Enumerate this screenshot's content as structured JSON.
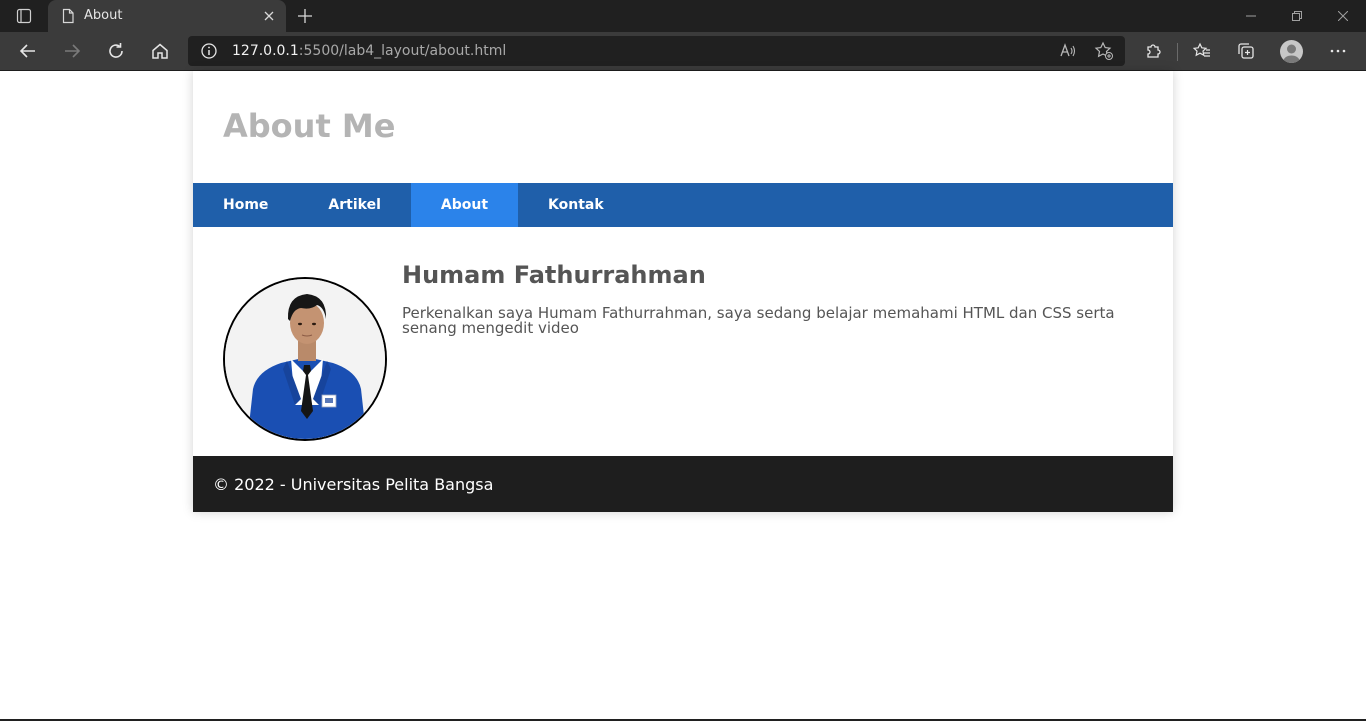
{
  "browser": {
    "tab_title": "About",
    "url_host": "127.0.0.1",
    "url_rest": ":5500/lab4_layout/about.html",
    "icons": {
      "tab_actions": "tab-actions-icon",
      "favicon": "page-icon",
      "close": "close-icon",
      "new_tab": "plus-icon",
      "back": "back-arrow-icon",
      "forward": "forward-arrow-icon",
      "refresh": "refresh-icon",
      "home": "home-icon",
      "info": "info-icon",
      "read_aloud": "read-aloud-icon",
      "add_favorite": "add-favorite-icon",
      "extensions": "puzzle-icon",
      "favorites": "favorites-icon",
      "collections": "collections-icon",
      "profile": "profile-avatar",
      "menu": "more-icon"
    }
  },
  "page": {
    "site_title": "About Me",
    "nav": {
      "items": [
        {
          "label": "Home",
          "active": false
        },
        {
          "label": "Artikel",
          "active": false
        },
        {
          "label": "About",
          "active": true
        },
        {
          "label": "Kontak",
          "active": false
        }
      ]
    },
    "profile": {
      "name": "Humam Fathurrahman",
      "bio": "Perkenalkan saya Humam Fathurrahman, saya sedang belajar memahami HTML dan CSS serta senang mengedit video"
    },
    "footer": {
      "text": "© 2022 - Universitas Pelita Bangsa"
    }
  },
  "colors": {
    "nav_bg": "#1f5faa",
    "nav_active": "#2b83ea",
    "footer_bg": "#1e1e1e",
    "title_gray": "#b4b4b4",
    "text_gray": "#555555",
    "jacket_blue": "#1a4fb3"
  }
}
